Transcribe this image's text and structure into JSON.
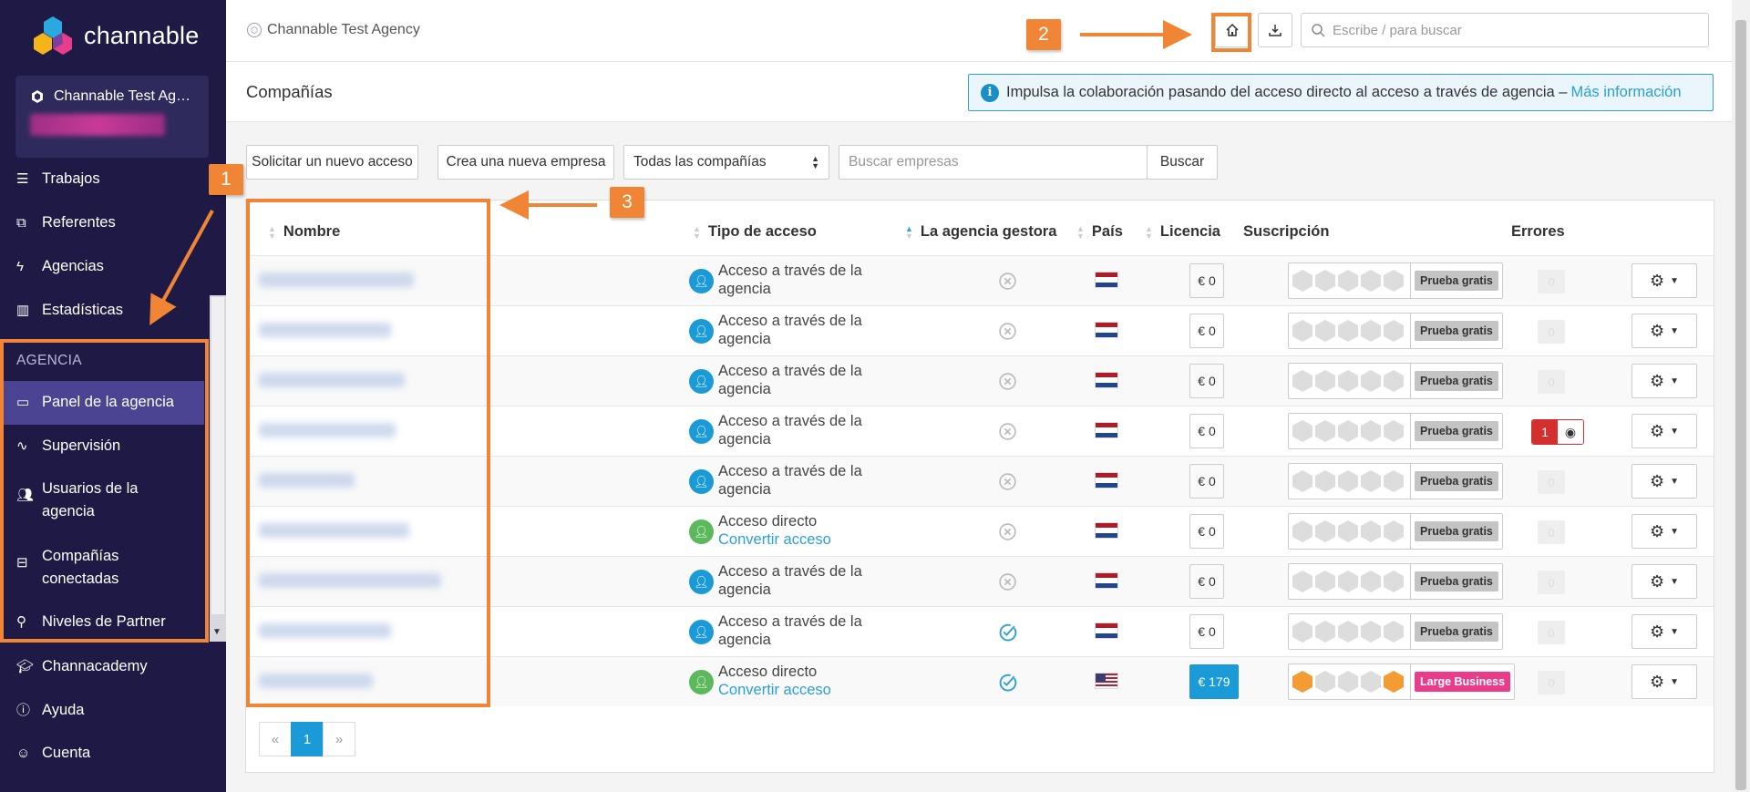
{
  "app": {
    "logo_text": "channable"
  },
  "sidebar": {
    "agency_name": "Channable Test Ag…",
    "items_top": [
      {
        "label": "Trabajos",
        "icon": "list-icon"
      },
      {
        "label": "Referentes",
        "icon": "sitemap-icon"
      },
      {
        "label": "Agencias",
        "icon": "bolt-icon"
      },
      {
        "label": "Estadísticas",
        "icon": "bar-chart-icon"
      }
    ],
    "section_label": "AGENCIA",
    "agency_items": [
      {
        "label": "Panel de la agencia",
        "icon": "monitor-icon",
        "active": true
      },
      {
        "label": "Supervisión",
        "icon": "pulse-icon"
      },
      {
        "label": "Usuarios de la agencia",
        "icon": "users-icon"
      },
      {
        "label": "Compañías conectadas",
        "icon": "briefcase-icon"
      },
      {
        "label": "Niveles de Partner",
        "icon": "award-icon"
      }
    ],
    "items_bottom": [
      {
        "label": "Channacademy",
        "icon": "graduation-cap-icon"
      },
      {
        "label": "Ayuda",
        "icon": "help-circle-icon"
      },
      {
        "label": "Cuenta",
        "icon": "user-icon"
      }
    ]
  },
  "topbar": {
    "breadcrumb": "Channable Test Agency",
    "search_placeholder": "Escribe / para buscar"
  },
  "header": {
    "title": "Compañías",
    "info_text": "Impulsa la colaboración pasando del acceso directo al acceso a través de agencia –",
    "info_link": "Más información"
  },
  "toolbar": {
    "request_access": "Solicitar un nuevo acceso",
    "create_company": "Crea una nueva empresa",
    "filter_value": "Todas las compañías",
    "search_placeholder": "Buscar empresas",
    "search_button": "Buscar"
  },
  "table": {
    "headers": {
      "name": "Nombre",
      "access": "Tipo de acceso",
      "agency": "La agencia gestora",
      "country": "País",
      "license": "Licencia",
      "subscription": "Suscripción",
      "errors": "Errores"
    },
    "rows": [
      {
        "access_type": "agency",
        "access_line1": "Acceso a través de la",
        "access_line2": "agencia",
        "managed": false,
        "country": "NL",
        "license": "€ 0",
        "plan": "Prueba gratis",
        "errors": "0"
      },
      {
        "access_type": "agency",
        "access_line1": "Acceso a través de la",
        "access_line2": "agencia",
        "managed": false,
        "country": "NL",
        "license": "€ 0",
        "plan": "Prueba gratis",
        "errors": "0"
      },
      {
        "access_type": "agency",
        "access_line1": "Acceso a través de la",
        "access_line2": "agencia",
        "managed": false,
        "country": "NL",
        "license": "€ 0",
        "plan": "Prueba gratis",
        "errors": "0"
      },
      {
        "access_type": "agency",
        "access_line1": "Acceso a través de la",
        "access_line2": "agencia",
        "managed": false,
        "country": "NL",
        "license": "€ 0",
        "plan": "Prueba gratis",
        "errors": "1"
      },
      {
        "access_type": "agency",
        "access_line1": "Acceso a través de la",
        "access_line2": "agencia",
        "managed": false,
        "country": "NL",
        "license": "€ 0",
        "plan": "Prueba gratis",
        "errors": "0"
      },
      {
        "access_type": "direct",
        "access_line1": "Acceso directo",
        "access_line2": "Convertir acceso",
        "managed": false,
        "country": "NL",
        "license": "€ 0",
        "plan": "Prueba gratis",
        "errors": "0"
      },
      {
        "access_type": "agency",
        "access_line1": "Acceso a través de la",
        "access_line2": "agencia",
        "managed": false,
        "country": "NL",
        "license": "€ 0",
        "plan": "Prueba gratis",
        "errors": "0"
      },
      {
        "access_type": "agency",
        "access_line1": "Acceso a través de la",
        "access_line2": "agencia",
        "managed": true,
        "country": "NL",
        "license": "€ 0",
        "plan": "Prueba gratis",
        "errors": "0"
      },
      {
        "access_type": "direct",
        "access_line1": "Acceso directo",
        "access_line2": "Convertir acceso",
        "managed": true,
        "country": "US",
        "license": "€ 179",
        "plan": "Large Business",
        "errors": "0"
      }
    ]
  },
  "pagination": {
    "prev": "«",
    "current": "1",
    "next": "»"
  },
  "annotations": [
    {
      "label": "1"
    },
    {
      "label": "2"
    },
    {
      "label": "3"
    }
  ],
  "colors": {
    "accent": "#f08535",
    "sidebar_bg": "#1e1a45",
    "link": "#2a9fd8"
  }
}
